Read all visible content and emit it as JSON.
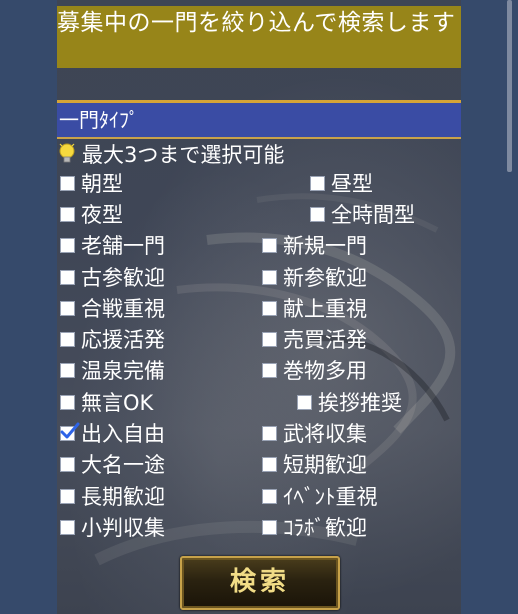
{
  "header": {
    "title": "募集中の一門を絞り込んで検索します"
  },
  "section": {
    "title": "一門ﾀｲﾌﾟ"
  },
  "hint": {
    "text": "最大3つまで選択可能"
  },
  "options": [
    {
      "label": "朝型",
      "checked": false
    },
    {
      "label": "昼型",
      "checked": false
    },
    {
      "label": "夜型",
      "checked": false
    },
    {
      "label": "全時間型",
      "checked": false
    },
    {
      "label": "老舗一門",
      "checked": false
    },
    {
      "label": "新規一門",
      "checked": false
    },
    {
      "label": "古参歓迎",
      "checked": false
    },
    {
      "label": "新参歓迎",
      "checked": false
    },
    {
      "label": "合戦重視",
      "checked": false
    },
    {
      "label": "献上重視",
      "checked": false
    },
    {
      "label": "応援活発",
      "checked": false
    },
    {
      "label": "売買活発",
      "checked": false
    },
    {
      "label": "温泉完備",
      "checked": false
    },
    {
      "label": "巻物多用",
      "checked": false
    },
    {
      "label": "無言OK",
      "checked": false
    },
    {
      "label": "挨拶推奨",
      "checked": false
    },
    {
      "label": "出入自由",
      "checked": true
    },
    {
      "label": "武将収集",
      "checked": false
    },
    {
      "label": "大名一途",
      "checked": false
    },
    {
      "label": "短期歓迎",
      "checked": false
    },
    {
      "label": "長期歓迎",
      "checked": false
    },
    {
      "label": "ｲﾍﾞﾝﾄ重視",
      "checked": false
    },
    {
      "label": "小判収集",
      "checked": false
    },
    {
      "label": "ｺﾗﾎﾞ歓迎",
      "checked": false
    }
  ],
  "search_button": {
    "label": "検索"
  },
  "colors": {
    "banner": "#978519",
    "section_bar": "#3a4ca4",
    "gold_rule": "#d5a436",
    "button_text": "#f1dc86",
    "page_bg": "#364a6b"
  }
}
